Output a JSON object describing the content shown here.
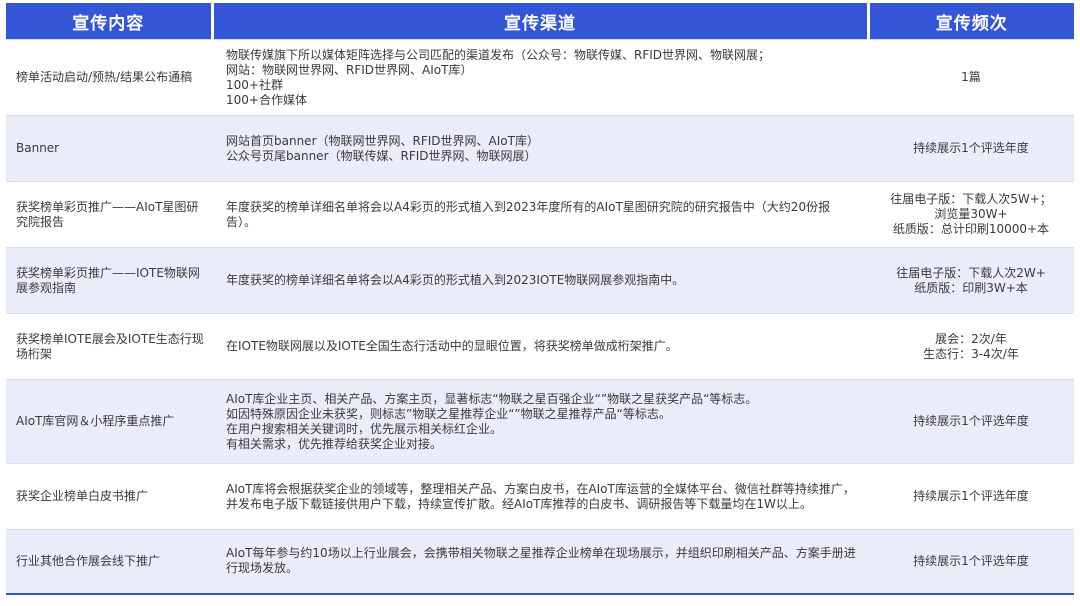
{
  "table": {
    "headers": [
      "宣传内容",
      "宣传渠道",
      "宣传频次"
    ],
    "rows": [
      {
        "content": "榜单活动启动/预热/结果公布通稿",
        "channel": [
          "物联传媒旗下所以媒体矩阵选择与公司匹配的渠道发布（公众号：物联传媒、RFID世界网、物联网展；",
          "网站：物联网世界网、RFID世界网、AIoT库）",
          "100+社群",
          "100+合作媒体"
        ],
        "frequency": [
          "1篇"
        ]
      },
      {
        "content": "Banner",
        "channel": [
          "网站首页banner（物联网世界网、RFID世界网、AIoT库）",
          "公众号页尾banner（物联传媒、RFID世界网、物联网展）"
        ],
        "frequency": [
          "持续展示1个评选年度"
        ]
      },
      {
        "content": "获奖榜单彩页推广——AIoT星图研究院报告",
        "channel": [
          "年度获奖的榜单详细名单将会以A4彩页的形式植入到2023年度所有的AIoT星图研究院的研究报告中（大约20份报告）。"
        ],
        "frequency": [
          "往届电子版：下载人次5W+；",
          "浏览量30W+",
          "纸质版：总计印刷10000+本"
        ]
      },
      {
        "content": "获奖榜单彩页推广——IOTE物联网展参观指南",
        "channel": [
          "年度获奖的榜单详细名单将会以A4彩页的形式植入到2023IOTE物联网展参观指南中。"
        ],
        "frequency": [
          "往届电子版：下载人次2W+",
          "纸质版：印刷3W+本"
        ]
      },
      {
        "content": "获奖榜单IOTE展会及IOTE生态行现场桁架",
        "channel": [
          "在IOTE物联网展以及IOTE全国生态行活动中的显眼位置，将获奖榜单做成桁架推广。"
        ],
        "frequency": [
          "展会：2次/年",
          "生态行：3-4次/年"
        ]
      },
      {
        "content": "AIoT库官网＆小程序重点推广",
        "channel": [
          "AIoT库企业主页、相关产品、方案主页，显著标志“物联之星百强企业“”物联之星获奖产品“等标志。",
          "如因特殊原因企业未获奖，则标志”物联之星推荐企业“”物联之星推荐产品“等标志。",
          "在用户搜索相关关键词时，优先展示相关标红企业。",
          "有相关需求，优先推荐给获奖企业对接。"
        ],
        "frequency": [
          "持续展示1个评选年度"
        ]
      },
      {
        "content": "获奖企业榜单白皮书推广",
        "channel": [
          "AIoT库将会根据获奖企业的领域等，整理相关产品、方案白皮书，在AIoT库运营的全媒体平台、微信社群等持续推广，并发布电子版下载链接供用户下载，持续宣传扩散。经AIoT库推荐的白皮书、调研报告等下载量均在1W以上。"
        ],
        "frequency": [
          "持续展示1个评选年度"
        ]
      },
      {
        "content": "行业其他合作展会线下推广",
        "channel": [
          "AIoT每年参与约10场以上行业展会，会携带相关物联之星推荐企业榜单在现场展示，并组织印刷相关产品、方案手册进行现场发放。"
        ],
        "frequency": [
          "持续展示1个评选年度"
        ]
      }
    ]
  }
}
